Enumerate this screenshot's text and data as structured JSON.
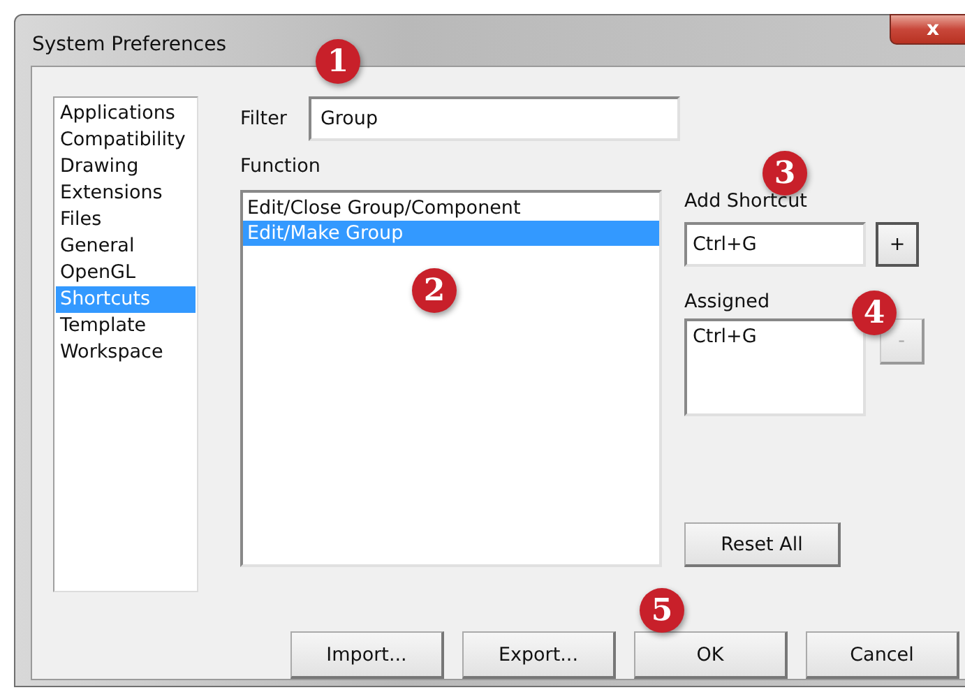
{
  "window": {
    "title": "System Preferences",
    "close": "x"
  },
  "sidebar": {
    "items": [
      {
        "label": "Applications",
        "selected": false
      },
      {
        "label": "Compatibility",
        "selected": false
      },
      {
        "label": "Drawing",
        "selected": false
      },
      {
        "label": "Extensions",
        "selected": false
      },
      {
        "label": "Files",
        "selected": false
      },
      {
        "label": "General",
        "selected": false
      },
      {
        "label": "OpenGL",
        "selected": false
      },
      {
        "label": "Shortcuts",
        "selected": true
      },
      {
        "label": "Template",
        "selected": false
      },
      {
        "label": "Workspace",
        "selected": false
      }
    ]
  },
  "filter": {
    "label": "Filter",
    "value": "Group"
  },
  "function": {
    "label": "Function",
    "items": [
      {
        "label": "Edit/Close Group/Component",
        "selected": false
      },
      {
        "label": "Edit/Make Group",
        "selected": true
      }
    ]
  },
  "add_shortcut": {
    "label": "Add Shortcut",
    "value": "Ctrl+G",
    "button": "+"
  },
  "assigned": {
    "label": "Assigned",
    "items": [
      "Ctrl+G"
    ],
    "button": "-",
    "button_disabled": true
  },
  "reset_button": "Reset All",
  "buttons": [
    "Import...",
    "Export...",
    "OK",
    "Cancel"
  ],
  "callouts": [
    {
      "label": "1"
    },
    {
      "label": "2"
    },
    {
      "label": "3"
    },
    {
      "label": "4"
    },
    {
      "label": "5"
    }
  ]
}
